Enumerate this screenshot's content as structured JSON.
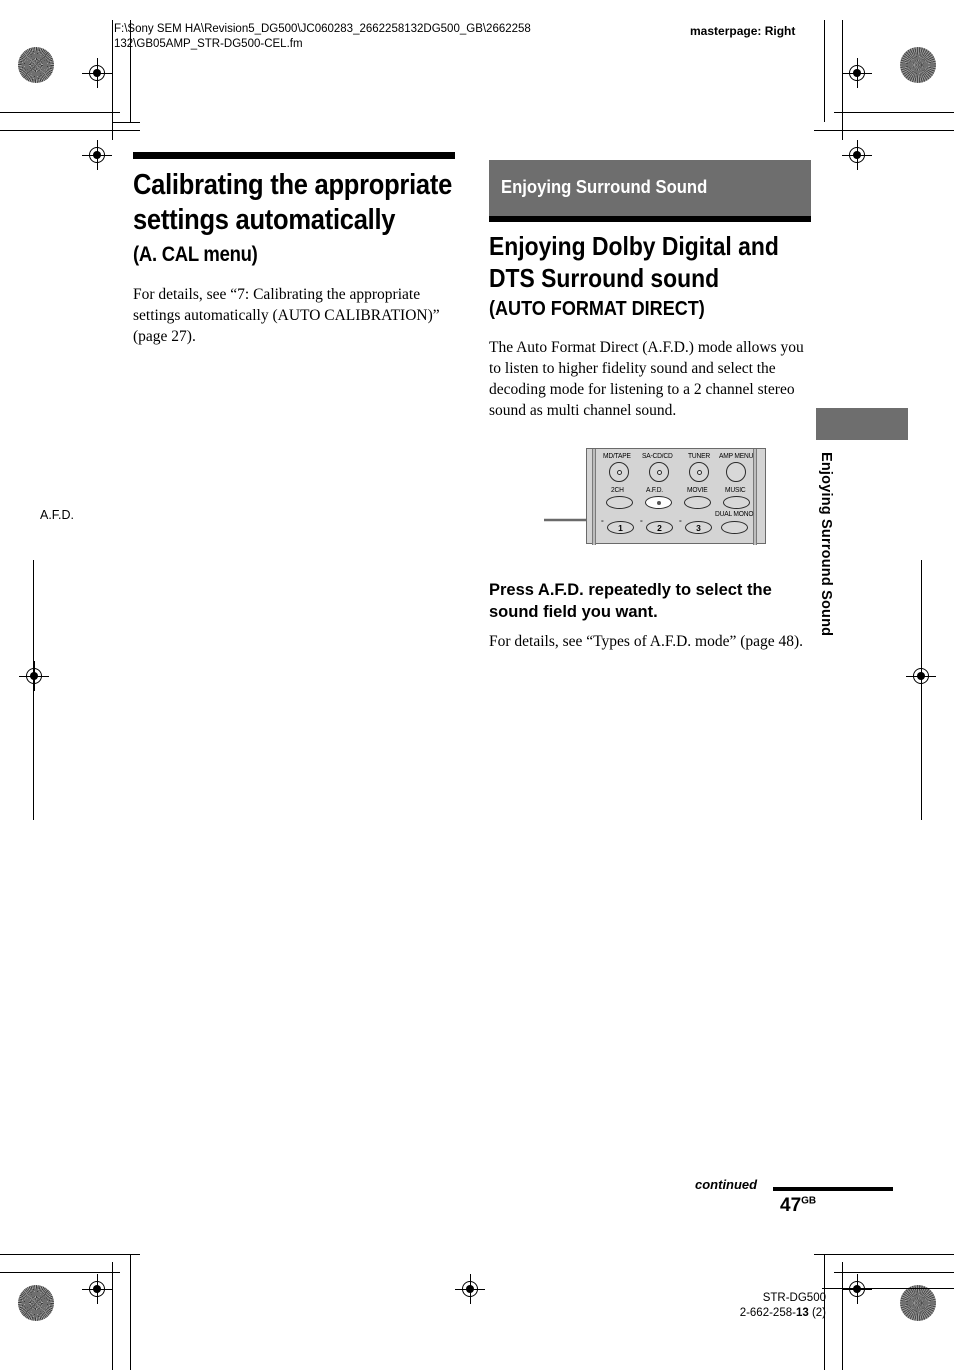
{
  "header": {
    "filepath": "F:\\Sony SEM HA\\Revision5_DG500\\JC060283_2662258132DG500_GB\\2662258132\\GB05AMP_STR-DG500-CEL.fm",
    "masterpage": "masterpage: Right"
  },
  "left_column": {
    "heading_main": "Calibrating the appropriate settings automatically",
    "heading_sub": "(A. CAL menu)",
    "body": "For details, see “7: Calibrating the appropriate settings automatically (AUTO CALIBRATION)” (page 27)."
  },
  "right_column": {
    "banner_title": "Enjoying Surround Sound",
    "heading_main": "Enjoying Dolby Digital and DTS Surround sound",
    "heading_sub": "(AUTO FORMAT DIRECT)",
    "intro": "The Auto Format Direct (A.F.D.) mode allows you to listen to higher fidelity sound and select the decoding mode for listening to a 2 channel stereo sound as multi channel sound.",
    "instruction": "Press A.F.D. repeatedly to select the sound field you want.",
    "details": "For details, see “Types of A.F.D. mode” (page 48)."
  },
  "diagram": {
    "callout_label": "A.F.D.",
    "row1": [
      {
        "label": "MD/TAPE",
        "type": "circle-dot"
      },
      {
        "label": "SA-CD/CD",
        "type": "circle-dot"
      },
      {
        "label": "TUNER",
        "type": "circle-dot"
      },
      {
        "label": "AMP MENU",
        "type": "circle-plain"
      }
    ],
    "row2": [
      {
        "label": "2CH",
        "type": "oval"
      },
      {
        "label": "A.F.D.",
        "type": "oval-highlight"
      },
      {
        "label": "MOVIE",
        "type": "oval"
      },
      {
        "label": "MUSIC",
        "type": "oval"
      }
    ],
    "row3": [
      {
        "label": "1",
        "type": "oval-number"
      },
      {
        "label": "2",
        "type": "oval-number"
      },
      {
        "label": "3",
        "type": "oval-number"
      }
    ],
    "row3_extra": {
      "label": "DUAL MONO",
      "type": "oval"
    }
  },
  "side_tab": {
    "text": "Enjoying Surround Sound"
  },
  "footer": {
    "continued": "continued",
    "page_number": "47",
    "page_suffix": "GB",
    "model": "STR-DG500",
    "part_prefix": "2-662-258-",
    "part_bold": "13",
    "part_suffix": " (2)"
  }
}
